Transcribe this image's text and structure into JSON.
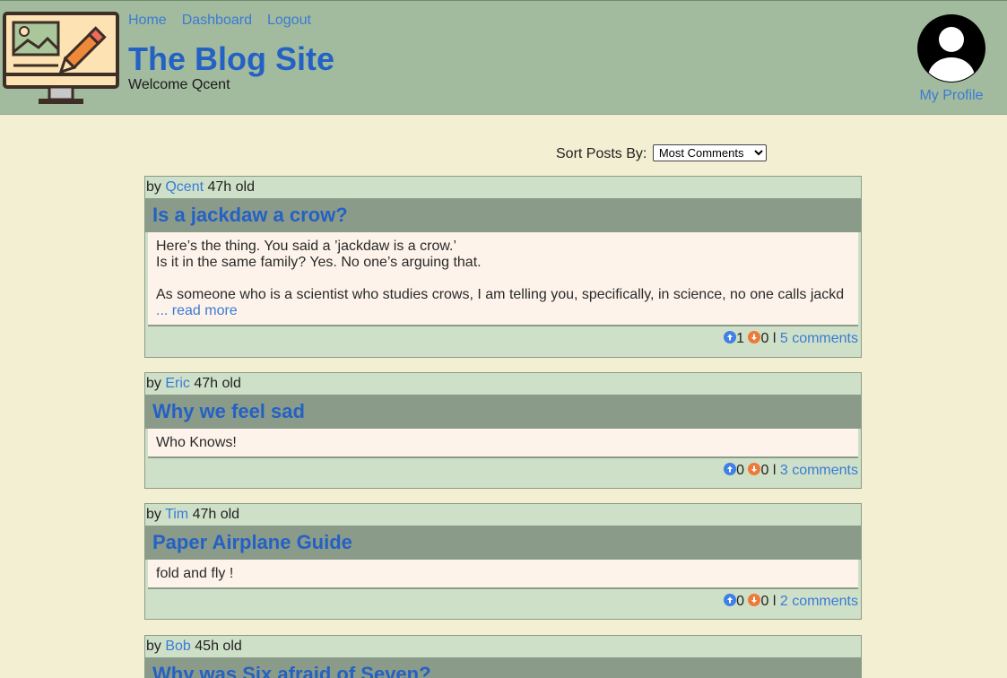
{
  "nav": {
    "home": "Home",
    "dashboard": "Dashboard",
    "logout": "Logout"
  },
  "site": {
    "title": "The Blog Site",
    "welcome": "Welcome Qcent"
  },
  "profile": {
    "label": "My Profile"
  },
  "sort": {
    "label": "Sort Posts By:",
    "selected": "Most Comments"
  },
  "posts": [
    {
      "by": "by",
      "author": "Qcent",
      "age": "47h old",
      "title": "Is a jackdaw a crow?",
      "body": [
        "Here’s the thing. You said a ’jackdaw is a crow.’",
        "Is it in the same family? Yes. No one’s arguing that.",
        "",
        "As someone who is a scientist who studies crows, I am telling you, specifically, in science, no one calls jackd"
      ],
      "read_more": "... read more",
      "upvotes": "1",
      "downvotes": "0",
      "sep": "l",
      "comments": "5 comments"
    },
    {
      "by": "by",
      "author": "Eric",
      "age": "47h old",
      "title": "Why we feel sad",
      "body": [
        "Who Knows!"
      ],
      "upvotes": "0",
      "downvotes": "0",
      "sep": "l",
      "comments": "3 comments"
    },
    {
      "by": "by",
      "author": "Tim",
      "age": "47h old",
      "title": "Paper Airplane Guide",
      "body": [
        "fold and fly !"
      ],
      "upvotes": "0",
      "downvotes": "0",
      "sep": "l",
      "comments": "2 comments"
    },
    {
      "by": "by",
      "author": "Bob",
      "age": "45h old",
      "title": "Why was Six afraid of Seven?"
    }
  ],
  "colors": {
    "header_bg": "#a2bb9e",
    "page_bg": "#f3efd3",
    "link": "#3a7bd5",
    "title": "#2461c4",
    "upvote": "#3f7fe8",
    "downvote": "#ee7a3a"
  }
}
